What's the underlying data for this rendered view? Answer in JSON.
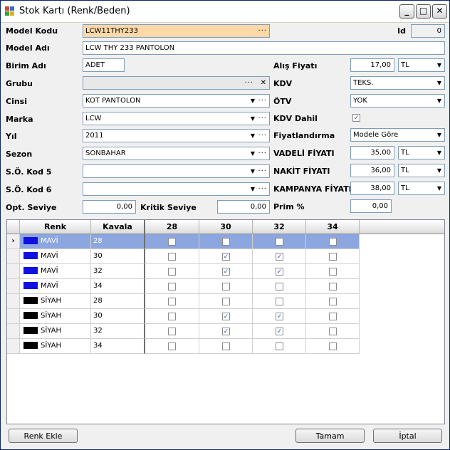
{
  "window": {
    "title": "Stok Kartı (Renk/Beden)",
    "min": "_",
    "max": "□",
    "close": "✕"
  },
  "form": {
    "model_kodu_label": "Model Kodu",
    "model_kodu": "LCW11THY233",
    "id_label": "Id",
    "id_value": "0",
    "model_adi_label": "Model Adı",
    "model_adi": "LCW THY 233 PANTOLON",
    "birim_adi_label": "Birim Adı",
    "birim_adi": "ADET",
    "grubu_label": "Grubu",
    "grubu": "",
    "cinsi_label": "Cinsi",
    "cinsi": "KOT PANTOLON",
    "marka_label": "Marka",
    "marka": "LCW",
    "yil_label": "Yıl",
    "yil": "2011",
    "sezon_label": "Sezon",
    "sezon": "SONBAHAR",
    "so_kod5_label": "S.Ö. Kod 5",
    "so_kod5": "",
    "so_kod6_label": "S.Ö. Kod 6",
    "so_kod6": "",
    "opt_seviye_label": "Opt. Seviye",
    "opt_seviye": "0,00",
    "kritik_seviye_label": "Kritik Seviye",
    "kritik_seviye": "0,00",
    "alis_fiyati_label": "Alış Fiyatı",
    "alis_fiyati": "17,00",
    "alis_currency": "TL",
    "kdv_label": "KDV",
    "kdv": "TEKS.",
    "otv_label": "ÖTV",
    "otv": "YOK",
    "kdv_dahil_label": "KDV Dahil",
    "kdv_dahil_checked": true,
    "fiyatlandirma_label": "Fiyatlandırma",
    "fiyatlandirma": "Modele Göre",
    "vadeli_label": "VADELİ FİYATI",
    "vadeli": "35,00",
    "vadeli_currency": "TL",
    "nakit_label": "NAKİT FİYATI",
    "nakit": "36,00",
    "nakit_currency": "TL",
    "kampanya_label": "KAMPANYA FİYATI",
    "kampanya": "38,00",
    "kampanya_currency": "TL",
    "prim_label": "Prim %",
    "prim": "0,00"
  },
  "grid": {
    "headers": [
      "Renk",
      "Kavala",
      "28",
      "30",
      "32",
      "34"
    ],
    "rows": [
      {
        "renk": "MAVİ",
        "color": "#1010e0",
        "kavala": "28",
        "checks": [
          false,
          false,
          false,
          false
        ],
        "selected": true
      },
      {
        "renk": "MAVİ",
        "color": "#1010e0",
        "kavala": "30",
        "checks": [
          false,
          true,
          true,
          false
        ],
        "selected": false
      },
      {
        "renk": "MAVİ",
        "color": "#1010e0",
        "kavala": "32",
        "checks": [
          false,
          true,
          true,
          false
        ],
        "selected": false
      },
      {
        "renk": "MAVİ",
        "color": "#1010e0",
        "kavala": "34",
        "checks": [
          false,
          false,
          false,
          false
        ],
        "selected": false
      },
      {
        "renk": "SİYAH",
        "color": "#000000",
        "kavala": "28",
        "checks": [
          false,
          false,
          false,
          false
        ],
        "selected": false
      },
      {
        "renk": "SİYAH",
        "color": "#000000",
        "kavala": "30",
        "checks": [
          false,
          true,
          true,
          false
        ],
        "selected": false
      },
      {
        "renk": "SİYAH",
        "color": "#000000",
        "kavala": "32",
        "checks": [
          false,
          true,
          true,
          false
        ],
        "selected": false
      },
      {
        "renk": "SİYAH",
        "color": "#000000",
        "kavala": "34",
        "checks": [
          false,
          false,
          false,
          false
        ],
        "selected": false
      }
    ]
  },
  "buttons": {
    "renk_ekle": "Renk Ekle",
    "tamam": "Tamam",
    "iptal": "İptal"
  },
  "glyphs": {
    "ellipsis": "···",
    "clear": "✕",
    "dropdown": "▼",
    "row_pointer": "›",
    "check": "✓"
  }
}
